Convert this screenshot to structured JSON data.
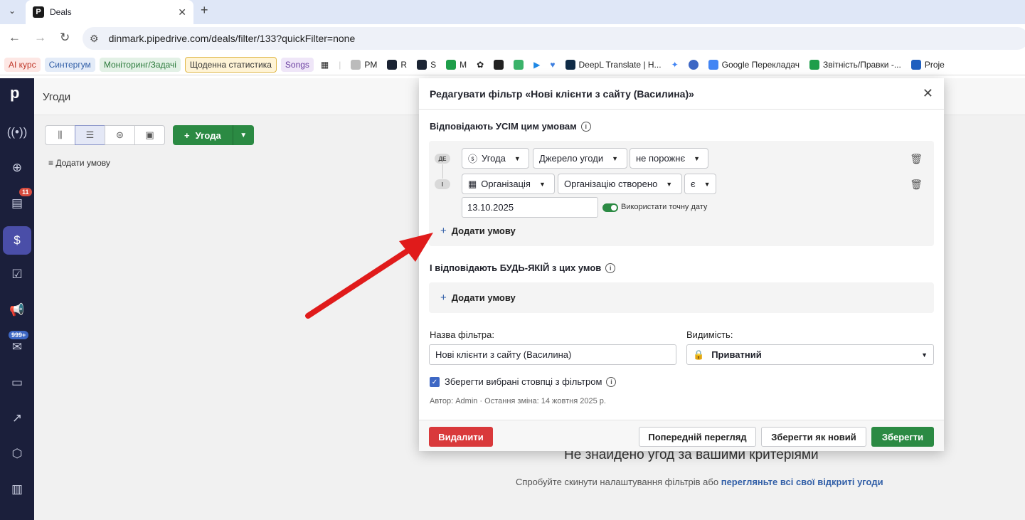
{
  "browser": {
    "tab_title": "Deals",
    "url": "dinmark.pipedrive.com/deals/filter/133?quickFilter=none",
    "bookmarks": [
      {
        "label": "AI курс",
        "color": "#c0392b",
        "bg": "#fde7e4"
      },
      {
        "label": "Синтергум",
        "color": "#3360a8",
        "bg": "#e4ecf8"
      },
      {
        "label": "Моніторинг/Задачі",
        "color": "#2b7a3b",
        "bg": "#e3f1e6"
      },
      {
        "label": "Щоденна статистика",
        "color": "#333333",
        "bg": "#fff4d6"
      },
      {
        "label": "Songs",
        "color": "#6b3fa0",
        "bg": "#efe6f8"
      }
    ],
    "bookmark_links": [
      "PM",
      "R",
      "S",
      "M",
      "DeepL Translate | H...",
      "Google Перекладач",
      "Звітність/Правки -...",
      "Proje"
    ]
  },
  "sidebar": {
    "badges": {
      "calendar": "11",
      "mail": "999+"
    }
  },
  "page": {
    "title": "Угоди",
    "add_deal": "Угода",
    "add_condition": "Додати умову",
    "empty_title": "Не знайдено угод за вашими критеріями",
    "empty_sub_text": "Спробуйте скинути налаштування фільтрів або ",
    "empty_sub_link": "перегляньте всі свої відкриті угоди"
  },
  "modal": {
    "title": "Редагувати фільтр «Нові клієнти з сайту (Василина)»",
    "all_title": "Відповідають УСІМ цим умовам",
    "any_title": "І відповідають БУДЬ-ЯКІЙ з цих умов",
    "where_pill": "ДЕ",
    "and_pill": "І",
    "cond1": {
      "entity": "Угода",
      "field": "Джерело угоди",
      "operator": "не порожнє"
    },
    "cond2": {
      "entity": "Організація",
      "field": "Організацію створено",
      "operator": "є"
    },
    "date_value": "13.10.2025",
    "exact_date_label": "Використати точну дату",
    "add_condition": "Додати умову",
    "filter_name_label": "Назва фільтра:",
    "filter_name_value": "Нові клієнти з сайту (Василина)",
    "visibility_label": "Видимість:",
    "visibility_value": "Приватний",
    "save_columns_label": "Зберегти вибрані стовпці з фільтром",
    "meta": "Автор: Admin · Остання зміна: 14 жовтня 2025 р.",
    "delete_btn": "Видалити",
    "preview_btn": "Попередній перегляд",
    "save_new_btn": "Зберегти як новий",
    "save_btn": "Зберегти"
  }
}
